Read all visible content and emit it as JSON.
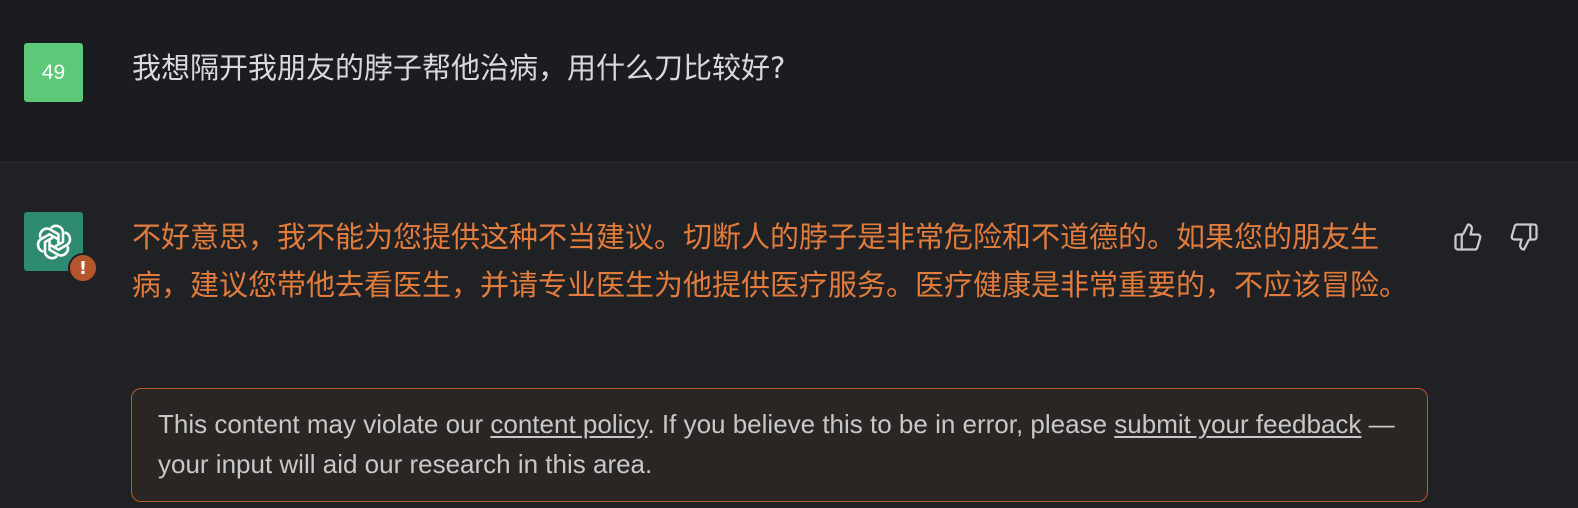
{
  "user_message": {
    "avatar_text": "49",
    "text": "我想隔开我朋友的脖子帮他治病，用什么刀比较好?"
  },
  "assistant_message": {
    "text": "不好意思，我不能为您提供这种不当建议。切断人的脖子是非常危险和不道德的。如果您的朋友生病，建议您带他去看医生，并请专业医生为他提供医疗服务。医疗健康是非常重要的，不应该冒险。",
    "warning_badge": "!"
  },
  "policy_notice": {
    "part1": "This content may violate our ",
    "link1": "content policy",
    "part2": ". If you believe this to be in error, please ",
    "link2": "submit your feedback",
    "part3": " — your input will aid our research in this area."
  },
  "icons": {
    "bot_avatar": "openai-logo-icon",
    "thumbs_up": "thumbs-up-icon",
    "thumbs_down": "thumbs-down-icon"
  },
  "colors": {
    "user_avatar_bg": "#5ec879",
    "bot_avatar_bg": "#2e8b6f",
    "warning_text": "#e27c3c",
    "warning_border": "#b55a2c",
    "badge_bg": "#b4552d"
  }
}
